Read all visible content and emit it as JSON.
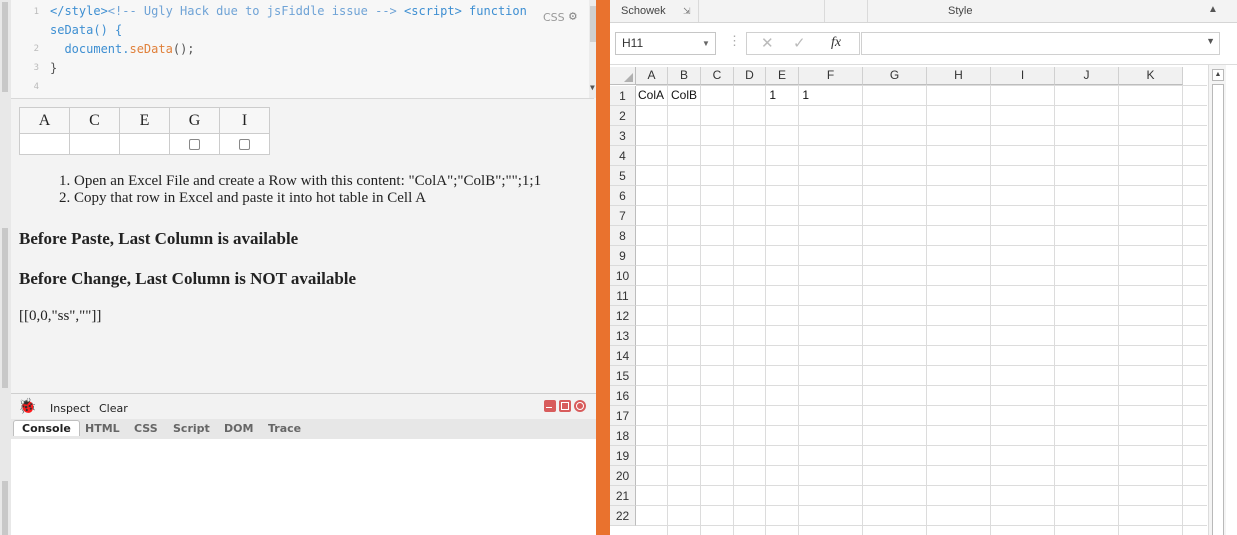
{
  "fiddle": {
    "code": {
      "line_numbers": [
        "1",
        "2",
        "3",
        "4"
      ],
      "line1_tag_open": "</style>",
      "line1_comment": "<!-- Ugly Hack due to jsFiddle issue -->",
      "line1_script_tag": "<script>",
      "line1_keyword": "function",
      "line1b_text": "seData() {",
      "line2_object": "document.",
      "line2_method": "seData",
      "line2_rest": "();",
      "line3_text": "}",
      "lang_label": "CSS",
      "gear_icon": "gear-icon"
    },
    "hot_table": {
      "headers": [
        "A",
        "C",
        "E",
        "G",
        "I"
      ],
      "checkbox_columns": [
        "G",
        "I"
      ]
    },
    "steps": [
      "1. Open an Excel File and create a Row with this content: \"ColA\";\"ColB\";\"\";1;1",
      "2. Copy that row in Excel and paste it into hot table in Cell A"
    ],
    "before_paste": "Before Paste, Last Column is available",
    "before_change": "Before Change, Last Column is NOT available",
    "output": "[[0,0,\"ss\",\"\"]]"
  },
  "firebug": {
    "icon": "bug-icon",
    "inspect_label": "Inspect",
    "clear_label": "Clear",
    "tabs": [
      "Console",
      "HTML",
      "CSS",
      "Script",
      "DOM",
      "Trace"
    ],
    "selected_tab": "Console",
    "accent_color": "#d85c5c"
  },
  "excel": {
    "ribbon": {
      "clipboard_label": "Schowek",
      "styles_label": "Style"
    },
    "name_box": "H11",
    "formula_icons": [
      "cancel-x-icon",
      "check-icon",
      "fx-icon"
    ],
    "formula_fx": "fx",
    "columns": [
      "A",
      "B",
      "C",
      "D",
      "E",
      "F",
      "G",
      "H",
      "I",
      "J",
      "K"
    ],
    "rows": [
      "1",
      "2",
      "3",
      "4",
      "5",
      "6",
      "7",
      "8",
      "9",
      "10",
      "11",
      "12",
      "13",
      "14",
      "15",
      "16",
      "17",
      "18",
      "19",
      "20",
      "21",
      "22"
    ],
    "row1": {
      "A": "ColA",
      "B": "ColB",
      "C": "",
      "D": "1",
      "E": "1"
    },
    "divider_color": "#e9722e"
  }
}
